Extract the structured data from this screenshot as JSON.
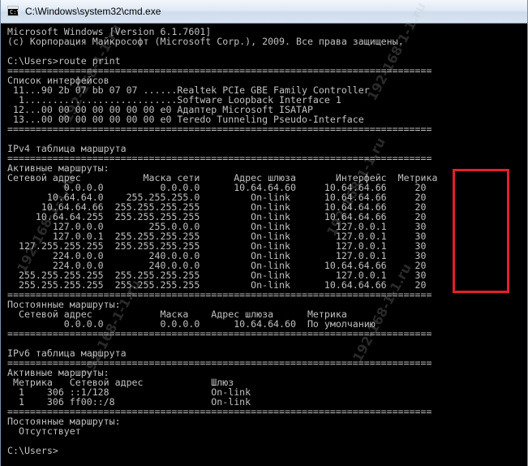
{
  "window": {
    "title": "C:\\Windows\\system32\\cmd.exe",
    "icon_label": "C:\\"
  },
  "console_lines": [
    "Microsoft Windows [Version 6.1.7601]",
    "(c) Корпорация Майкрософт (Microsoft Corp.), 2009. Все права защищены.",
    "",
    "C:\\Users>route print",
    "===========================================================================",
    "Список интерфейсов",
    " 11...90 2b 07 bb 07 07 ......Realtek PCIe GBE Family Controller",
    "  1...........................Software Loopback Interface 1",
    " 12...00 00 00 00 00 00 00 e0 Адаптер Microsoft ISATAP",
    " 13...00 00 00 00 00 00 00 e0 Teredo Tunneling Pseudo-Interface",
    "===========================================================================",
    "",
    "IPv4 таблица маршрута",
    "===========================================================================",
    "Активные маршруты:",
    "Сетевой адрес           Маска сети      Адрес шлюза       Интерфейс  Метрика",
    "          0.0.0.0          0.0.0.0      10.64.64.60     10.64.64.66     20",
    "       10.64.64.0    255.255.255.0         On-link      10.64.64.66     20",
    "      10.64.64.66  255.255.255.255         On-link      10.64.64.66     20",
    "     10.64.64.255  255.255.255.255         On-link      10.64.64.66     20",
    "        127.0.0.0        255.0.0.0         On-link        127.0.0.1     30",
    "        127.0.0.1  255.255.255.255         On-link        127.0.0.1     30",
    "  127.255.255.255  255.255.255.255         On-link        127.0.0.1     30",
    "        224.0.0.0        240.0.0.0         On-link        127.0.0.1     30",
    "        224.0.0.0        240.0.0.0         On-link      10.64.64.66     20",
    "  255.255.255.255  255.255.255.255         On-link        127.0.0.1     30",
    "  255.255.255.255  255.255.255.255         On-link      10.64.64.66     20",
    "===========================================================================",
    "Постоянные маршруты:",
    "  Сетевой адрес            Маска    Адрес шлюза      Метрика",
    "          0.0.0.0          0.0.0.0      10.64.64.60  По умолчанию",
    "===========================================================================",
    "",
    "IPv6 таблица маршрута",
    "===========================================================================",
    "Активные маршруты:",
    " Метрика   Сетевой адрес            Шлюз",
    "  1    306 ::1/128                  On-link",
    "  1    306 ff00::/8                 On-link",
    "===========================================================================",
    "Постоянные маршруты:",
    "  Отсутствует",
    "",
    "C:\\Users>"
  ],
  "watermark_text": "192-168-1-1.ru",
  "colors": {
    "console_background": "#000000",
    "console_text": "#c0c0c0",
    "highlight_border": "#e0202a"
  }
}
